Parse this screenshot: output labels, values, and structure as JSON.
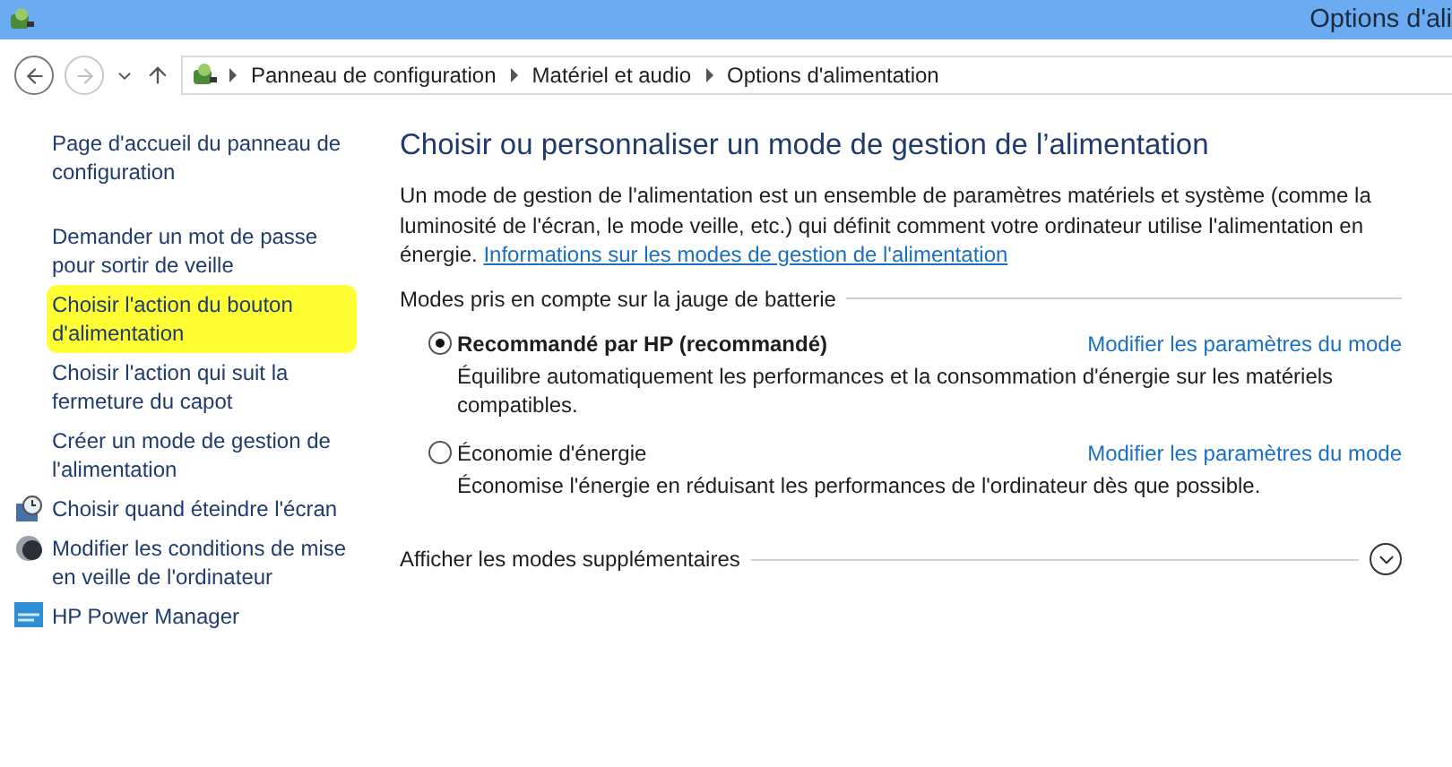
{
  "window": {
    "title": "Options d'ali"
  },
  "nav": {
    "back_disabled": false,
    "forward_disabled": true,
    "breadcrumb": [
      "Panneau de configuration",
      "Matériel et audio",
      "Options d'alimentation"
    ]
  },
  "sidebar": {
    "items": [
      {
        "label": "Page d'accueil du panneau de configuration",
        "kind": "text",
        "highlighted": false
      },
      {
        "label": "Demander un mot de passe pour sortir de veille",
        "kind": "text",
        "highlighted": false
      },
      {
        "label": "Choisir l'action du bouton d'alimentation",
        "kind": "text",
        "highlighted": true
      },
      {
        "label": "Choisir l'action qui suit la fermeture du capot",
        "kind": "text",
        "highlighted": false
      },
      {
        "label": "Créer un mode de gestion de l'alimentation",
        "kind": "text",
        "highlighted": false
      },
      {
        "label": "Choisir quand éteindre l'écran",
        "kind": "clock",
        "highlighted": false
      },
      {
        "label": "Modifier les conditions de mise en veille de l'ordinateur",
        "kind": "moon",
        "highlighted": false
      },
      {
        "label": "HP Power Manager",
        "kind": "panel",
        "highlighted": false
      }
    ]
  },
  "main": {
    "heading": "Choisir ou personnaliser un mode de gestion de l’alimentation",
    "intro": "Un mode de gestion de l'alimentation est un ensemble de paramètres matériels et système (comme la luminosité de l'écran, le mode veille, etc.) qui définit comment votre ordinateur utilise l'alimentation en énergie.",
    "intro_link": "Informations sur les modes de gestion de l'alimentation",
    "group_label": "Modes pris en compte sur la jauge de batterie",
    "plans": [
      {
        "name": "Recommandé par HP (recommandé)",
        "selected": true,
        "link": "Modifier les paramètres du mode",
        "description": "Équilibre automatiquement les performances et la consommation d'énergie sur les matériels compatibles."
      },
      {
        "name": "Économie d'énergie",
        "selected": false,
        "link": "Modifier les paramètres du mode",
        "description": "Économise l'énergie en réduisant les performances de l'ordinateur dès que possible."
      }
    ],
    "more_label": "Afficher les modes supplémentaires",
    "more_expanded": false
  }
}
